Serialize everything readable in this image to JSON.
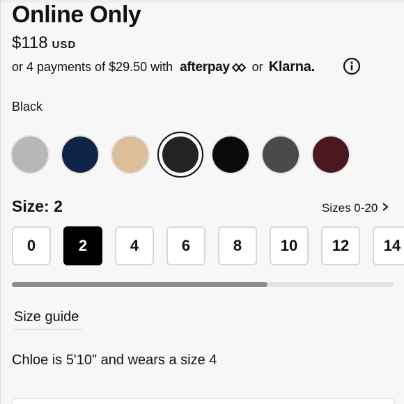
{
  "product": {
    "badge_title": "Online Only",
    "price": "$118",
    "currency": "USD"
  },
  "payments": {
    "text": "or 4 payments of $29.50 with",
    "provider_1": "afterpay",
    "or_text": "or",
    "provider_2": "Klarna."
  },
  "color": {
    "selected_name": "Black",
    "swatches": [
      {
        "name": "light-gray",
        "hex": "#b7b7b7"
      },
      {
        "name": "navy",
        "hex": "#0f2447"
      },
      {
        "name": "nude",
        "hex": "#dcbf9a"
      },
      {
        "name": "black-selected",
        "hex": "#232323"
      },
      {
        "name": "black",
        "hex": "#0b0b0b"
      },
      {
        "name": "charcoal",
        "hex": "#4a4a4c"
      },
      {
        "name": "burgundy",
        "hex": "#4b1820"
      }
    ]
  },
  "size": {
    "label": "Size: 2",
    "range_link": "Sizes 0-20",
    "options": [
      "0",
      "2",
      "4",
      "6",
      "8",
      "10",
      "12",
      "14"
    ],
    "selected": "2",
    "scroll_position": 0.67
  },
  "size_guide_label": "Size guide",
  "model_info": "Chloe is 5'10\" and wears a size 4",
  "colors": {
    "accent": "#000000",
    "background": "#f7f7f7"
  }
}
